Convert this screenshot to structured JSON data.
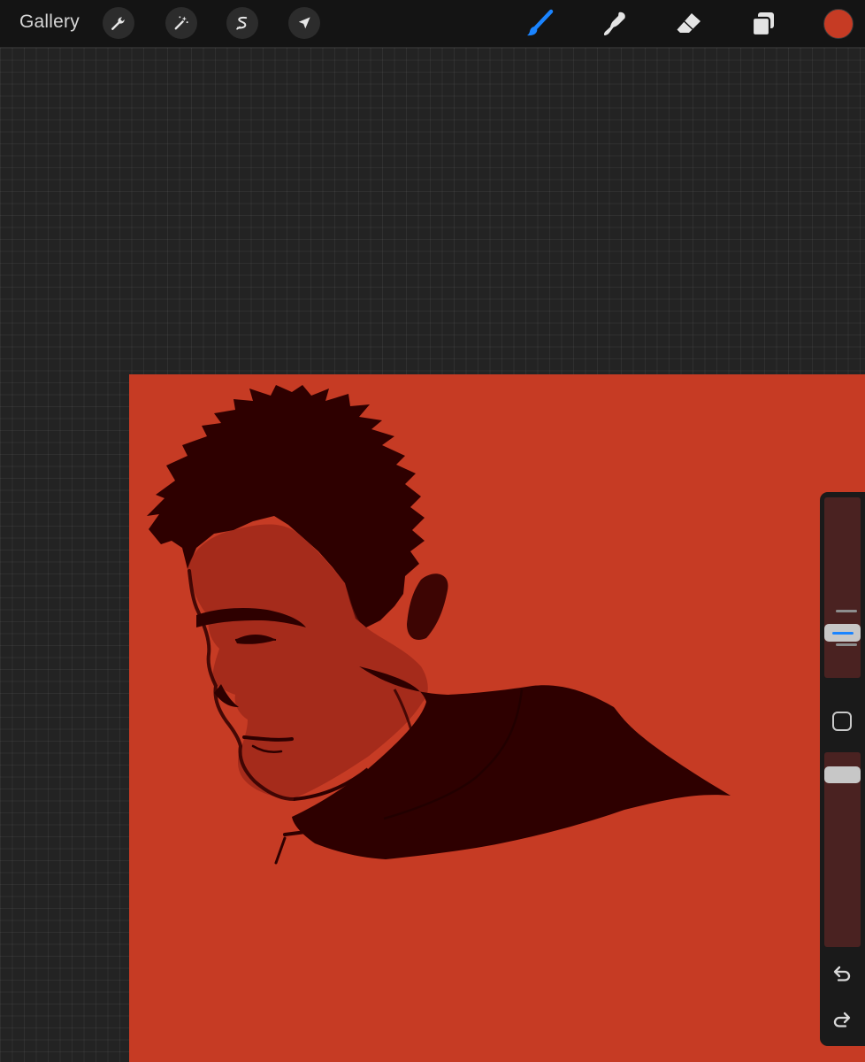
{
  "toolbar": {
    "gallery_label": "Gallery",
    "left_tools": [
      "wrench-icon",
      "magic-wand-icon",
      "selection-icon",
      "transform-arrow-icon"
    ],
    "right_tools": [
      "brush-icon",
      "smudge-icon",
      "eraser-icon",
      "layers-icon"
    ],
    "active_tool": "brush-icon",
    "active_tool_color": "#1a84ff",
    "current_color": "#c63b24"
  },
  "canvas": {
    "background_color": "#c63b24",
    "ink_color": "#2e0000",
    "subject": "sketch-of-man-head-profile"
  },
  "sidebar": {
    "brush_size_fraction": 0.74,
    "opacity_fraction": 0.92,
    "icons": [
      "modify-square-icon",
      "undo-icon",
      "redo-icon"
    ]
  }
}
